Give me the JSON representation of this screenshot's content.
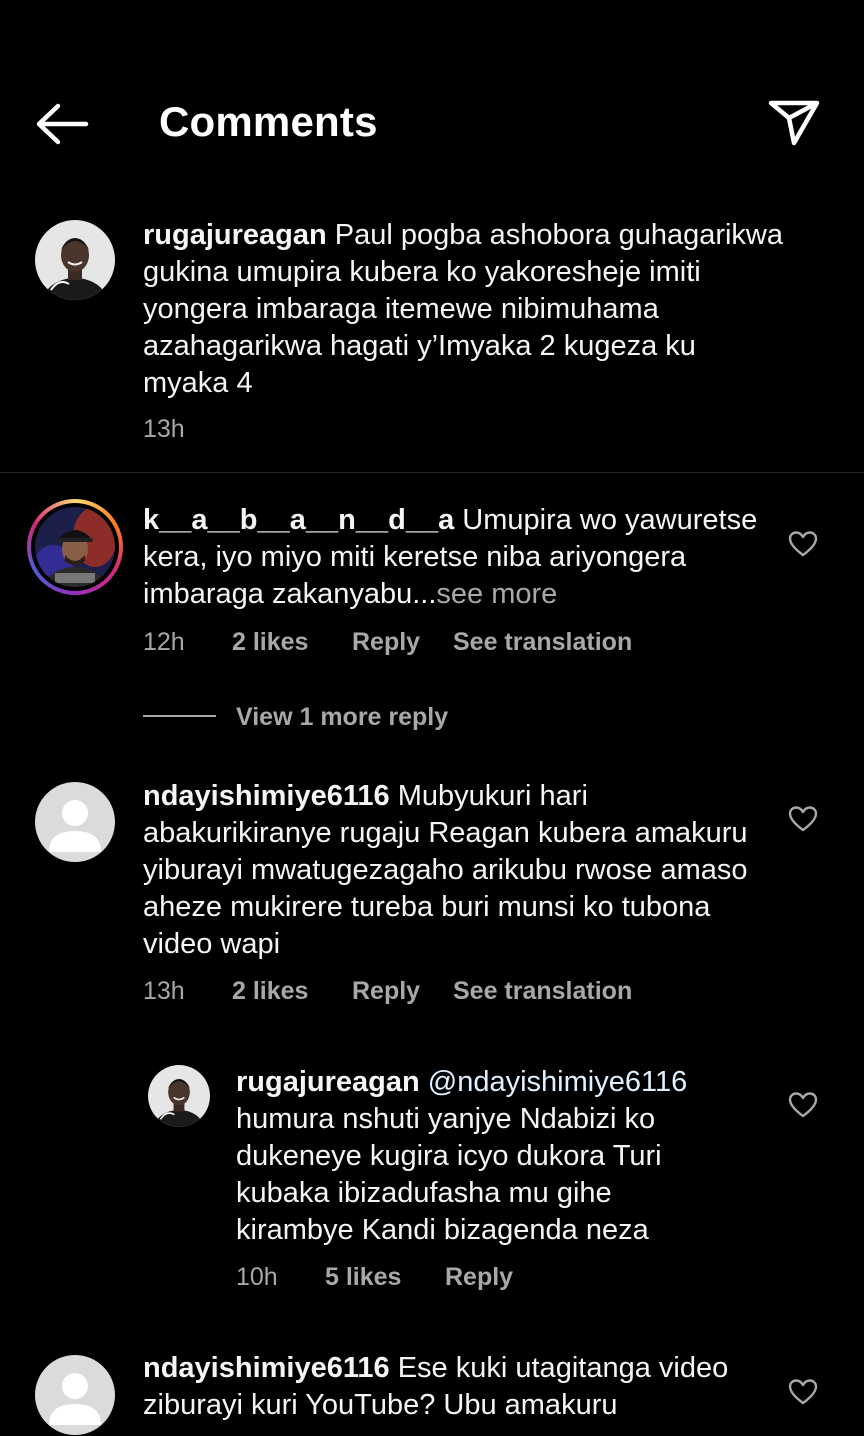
{
  "header": {
    "title": "Comments",
    "back_icon": "arrow-left-icon",
    "share_icon": "paper-plane-icon"
  },
  "caption": {
    "username": "rugajureagan",
    "text": "Paul pogba ashobora guhagarikwa gukina umupira kubera ko yakoresheje imiti yongera imbaraga itemewe nibimuhama azahagarikwa hagati y’Imyaka 2 kugeza ku myaka 4",
    "time": "13h"
  },
  "comments": [
    {
      "username": "k__a__b__a__n__d__a",
      "text": "Umupira wo yawuretse kera, iyo miyo miti keretse niba ariyongera imbaraga zakanyabu...",
      "see_more": "see more",
      "time": "12h",
      "likes": "2 likes",
      "reply": "Reply",
      "translate": "See translation",
      "has_story_ring": true
    },
    {
      "username": "ndayishimiye6116",
      "text": "Mubyukuri hari abakurikiranye rugaju Reagan kubera amakuru yiburayi mwatugezagaho arikubu rwose  amaso aheze mukirere tureba buri munsi ko tubona video wapi",
      "time": "13h",
      "likes": "2 likes",
      "reply": "Reply",
      "translate": "See translation"
    },
    {
      "username": "ndayishimiye6116",
      "text": "Ese kuki utagitanga video ziburayi kuri YouTube? Ubu amakuru"
    }
  ],
  "view_more": {
    "label": "View 1 more reply"
  },
  "reply": {
    "username": "rugajureagan",
    "mention": "@ndayishimiye6116",
    "text": "humura nshuti yanjye Ndabizi ko dukeneye kugira icyo dukora Turi kubaka ibizadufasha mu gihe kirambye Kandi bizagenda neza",
    "time": "10h",
    "likes": "5 likes",
    "reply": "Reply"
  },
  "colors": {
    "background": "#000000",
    "text": "#f5f5f5",
    "secondary": "#a8a8a8",
    "story_ring": [
      "#feda75",
      "#fa7e1e",
      "#d62976",
      "#962fbf"
    ]
  }
}
